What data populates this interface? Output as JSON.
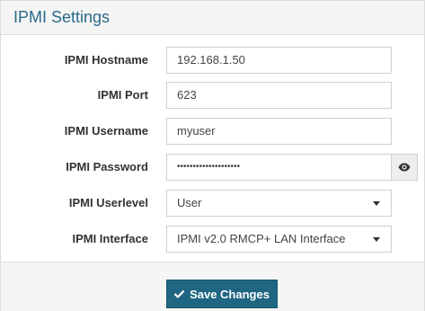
{
  "panel": {
    "title": "IPMI Settings"
  },
  "fields": {
    "hostname": {
      "label": "IPMI Hostname",
      "value": "192.168.1.50"
    },
    "port": {
      "label": "IPMI Port",
      "value": "623"
    },
    "username": {
      "label": "IPMI Username",
      "value": "myuser"
    },
    "password": {
      "label": "IPMI Password",
      "value": "••••••••••••••••••••",
      "toggle_icon": "eye-icon"
    },
    "userlevel": {
      "label": "IPMI Userlevel",
      "selected": "User"
    },
    "interface": {
      "label": "IPMI Interface",
      "selected": "IPMI v2.0 RMCP+ LAN Interface"
    }
  },
  "actions": {
    "save_label": "Save Changes",
    "save_icon": "check-icon"
  },
  "colors": {
    "title": "#2a6a8a",
    "primary_button": "#1f6682",
    "header_bg": "#f5f5f5"
  }
}
